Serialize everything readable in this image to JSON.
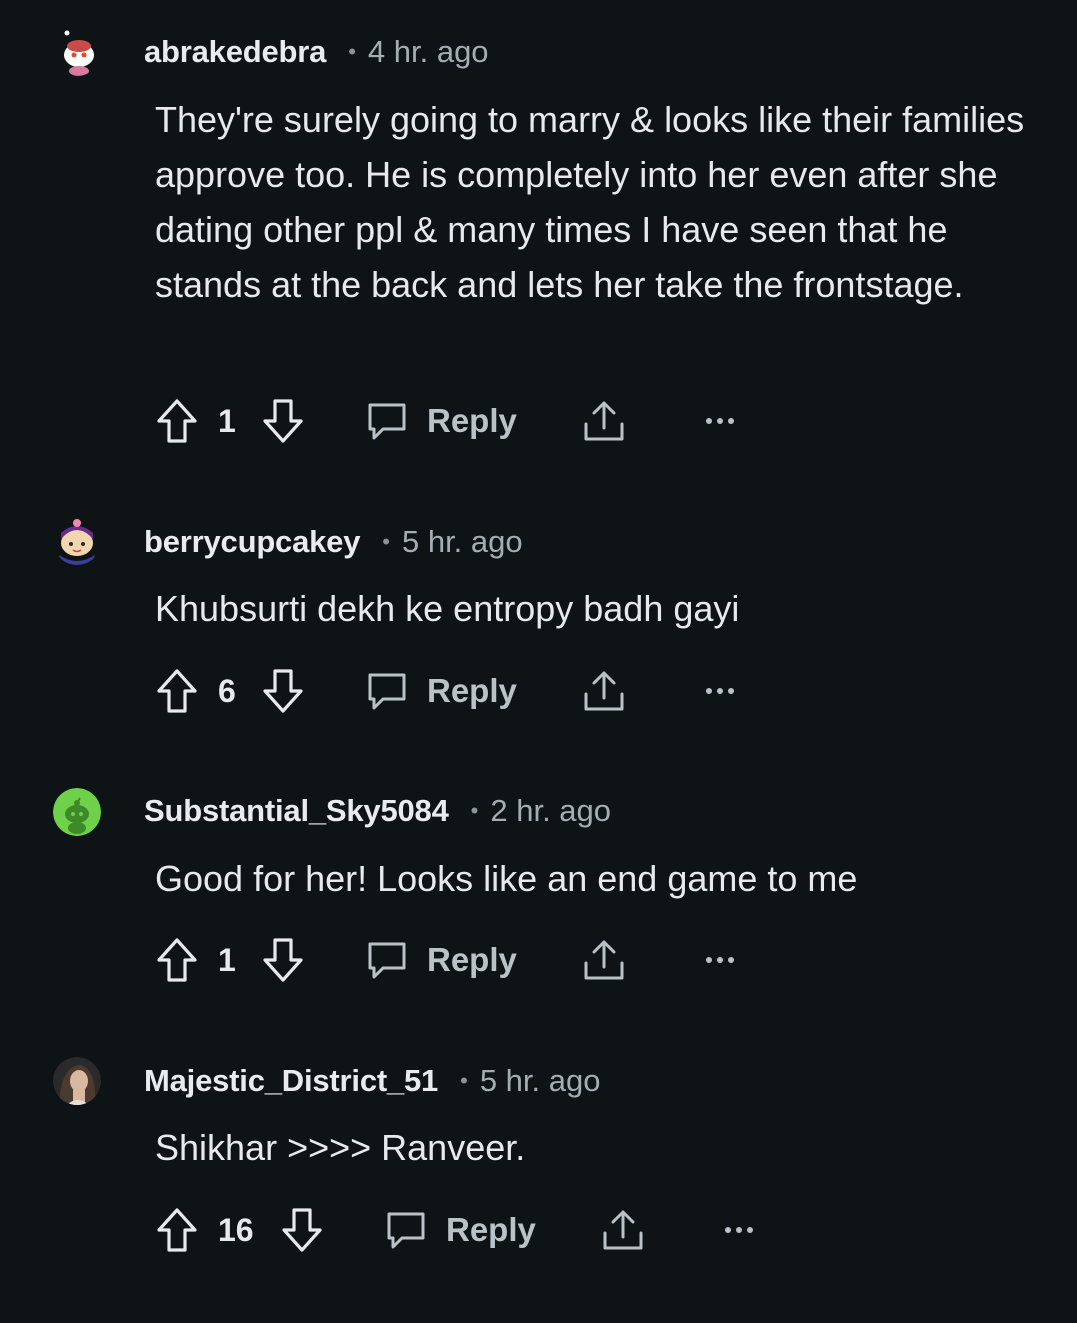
{
  "comments": [
    {
      "username": "abrakedebra",
      "time": "4 hr. ago",
      "body": "They're surely going to marry & looks like their families approve too. He is completely into her even after she dating other ppl & many times I have seen that he stands at the back and lets her take the frontstage.",
      "score": "1",
      "reply_label": "Reply",
      "avatar_icon": "snoo-avatar-icon"
    },
    {
      "username": "berrycupcakey",
      "time": "5 hr. ago",
      "body": "Khubsurti dekh ke entropy badh gayi",
      "score": "6",
      "reply_label": "Reply",
      "avatar_icon": "snoo-avatar-icon"
    },
    {
      "username": "Substantial_Sky5084",
      "time": "2 hr. ago",
      "body": "Good for her! Looks like an end game to me",
      "score": "1",
      "reply_label": "Reply",
      "avatar_icon": "snoo-avatar-icon"
    },
    {
      "username": "Majestic_District_51",
      "time": "5 hr. ago",
      "body": "Shikhar >>>> Ranveer.",
      "score": "16",
      "reply_label": "Reply",
      "avatar_icon": "user-photo-avatar-icon"
    }
  ],
  "colors": {
    "background": "#0e1416",
    "text": "#e6eaec",
    "muted": "#a4aeb2",
    "green_avatar": "#6fd14a"
  },
  "separator": "•",
  "more_icon": "more-options-icon"
}
